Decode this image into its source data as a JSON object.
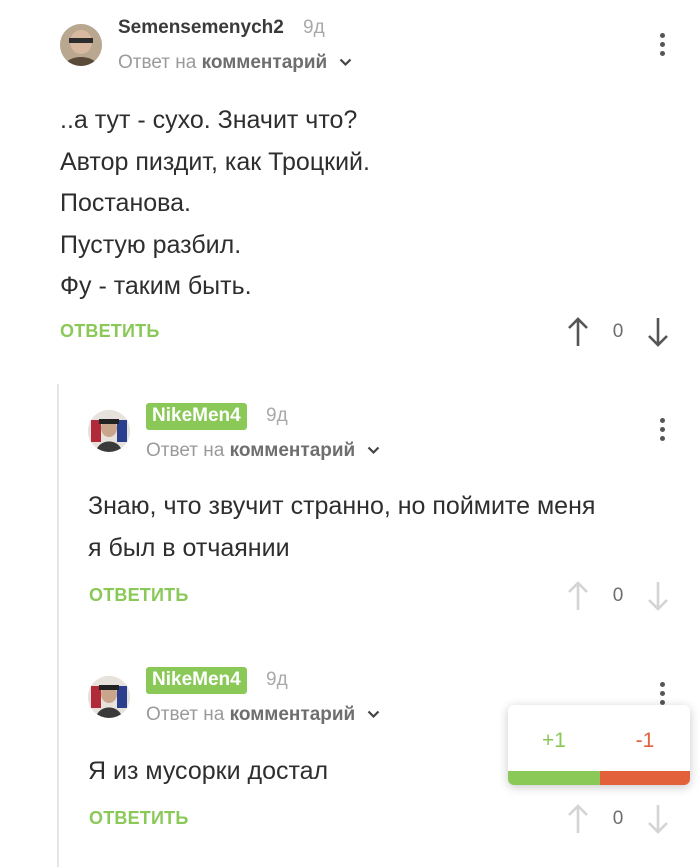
{
  "comments": [
    {
      "username": "Semensemenych2",
      "time": "9д",
      "reply_prefix": "Ответ на",
      "reply_target": "комментарий",
      "lines": [
        "..а тут - сухо. Значит что?",
        "Автор пиздит, как Троцкий.",
        "Постанова.",
        "Пустую разбил.",
        "Фу - таким быть."
      ],
      "reply_label": "ОТВЕТИТЬ",
      "score": "0"
    },
    {
      "username": "NikeMen4",
      "time": "9д",
      "reply_prefix": "Ответ на",
      "reply_target": "комментарий",
      "lines": [
        "Знаю, что звучит странно, но поймите меня",
        "я был в отчаянии"
      ],
      "reply_label": "ОТВЕТИТЬ",
      "score": "0"
    },
    {
      "username": "NikeMen4",
      "time": "9д",
      "reply_prefix": "Ответ на",
      "reply_target": "комментарий",
      "lines": [
        "Я из мусорки достал"
      ],
      "reply_label": "ОТВЕТИТЬ",
      "score": "0"
    }
  ],
  "vote_popup": {
    "plus": "+1",
    "minus": "-1"
  },
  "colors": {
    "accent_green": "#8ac858",
    "minus_orange": "#e2613a"
  }
}
